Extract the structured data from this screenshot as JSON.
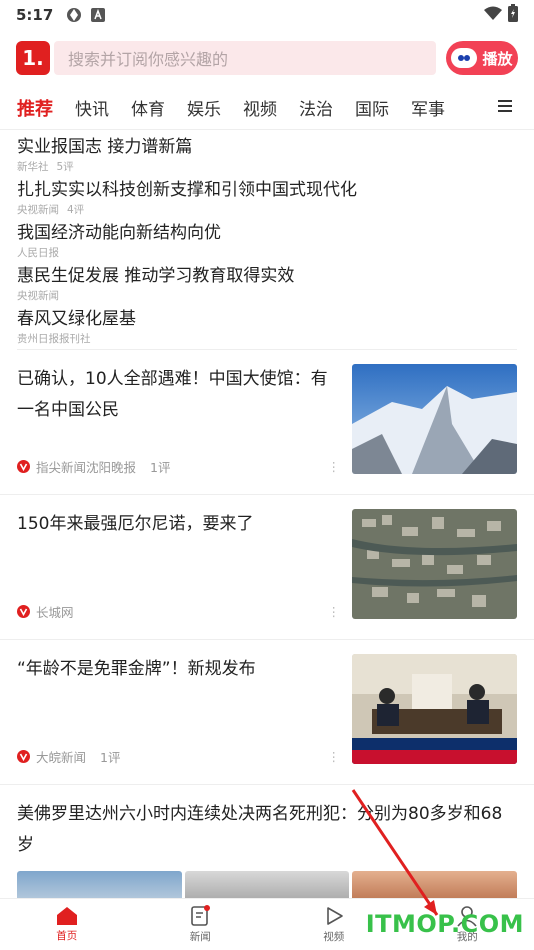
{
  "status": {
    "time": "5:17"
  },
  "header": {
    "logo_text": "1.",
    "search_placeholder": "搜索并订阅你感兴趣的",
    "play_label": "播放"
  },
  "tabs": [
    "推荐",
    "快讯",
    "体育",
    "娱乐",
    "视频",
    "法治",
    "国际",
    "军事"
  ],
  "top_news": [
    {
      "title": "实业报国志 接力谱新篇",
      "source": "新华社",
      "comments": "5评"
    },
    {
      "title": "扎扎实实以科技创新支撑和引领中国式现代化",
      "source": "央视新闻",
      "comments": "4评"
    },
    {
      "title": "我国经济动能向新结构向优",
      "source": "人民日报",
      "comments": ""
    },
    {
      "title": "惠民生促发展 推动学习教育取得实效",
      "source": "央视新闻",
      "comments": ""
    },
    {
      "title": "春风又绿化屋基",
      "source": "贵州日报报刊社",
      "comments": ""
    }
  ],
  "news": [
    {
      "title": "已确认，10人全部遇难！中国大使馆：有一名中国公民",
      "source": "指尖新闻沈阳晚报",
      "comments": "1评",
      "image": "mountain"
    },
    {
      "title": "150年来最强厄尔尼诺，要来了",
      "source": "长城网",
      "comments": "",
      "image": "flood"
    },
    {
      "title": "“年龄不是免罪金牌”！新规发布",
      "source": "大皖新闻",
      "comments": "1评",
      "image": "office"
    }
  ],
  "wide_news": {
    "title": "美佛罗里达州六小时内连续处决两名死刑犯：分别为80多岁和68岁"
  },
  "bottom_nav": [
    "首页",
    "新闻",
    "视频",
    "我的"
  ],
  "watermark": "ITMOP.COM",
  "colors": {
    "accent": "#e02020",
    "play_button": "#f24155",
    "search_bg": "#fbe8ea",
    "watermark": "#38c14a"
  }
}
